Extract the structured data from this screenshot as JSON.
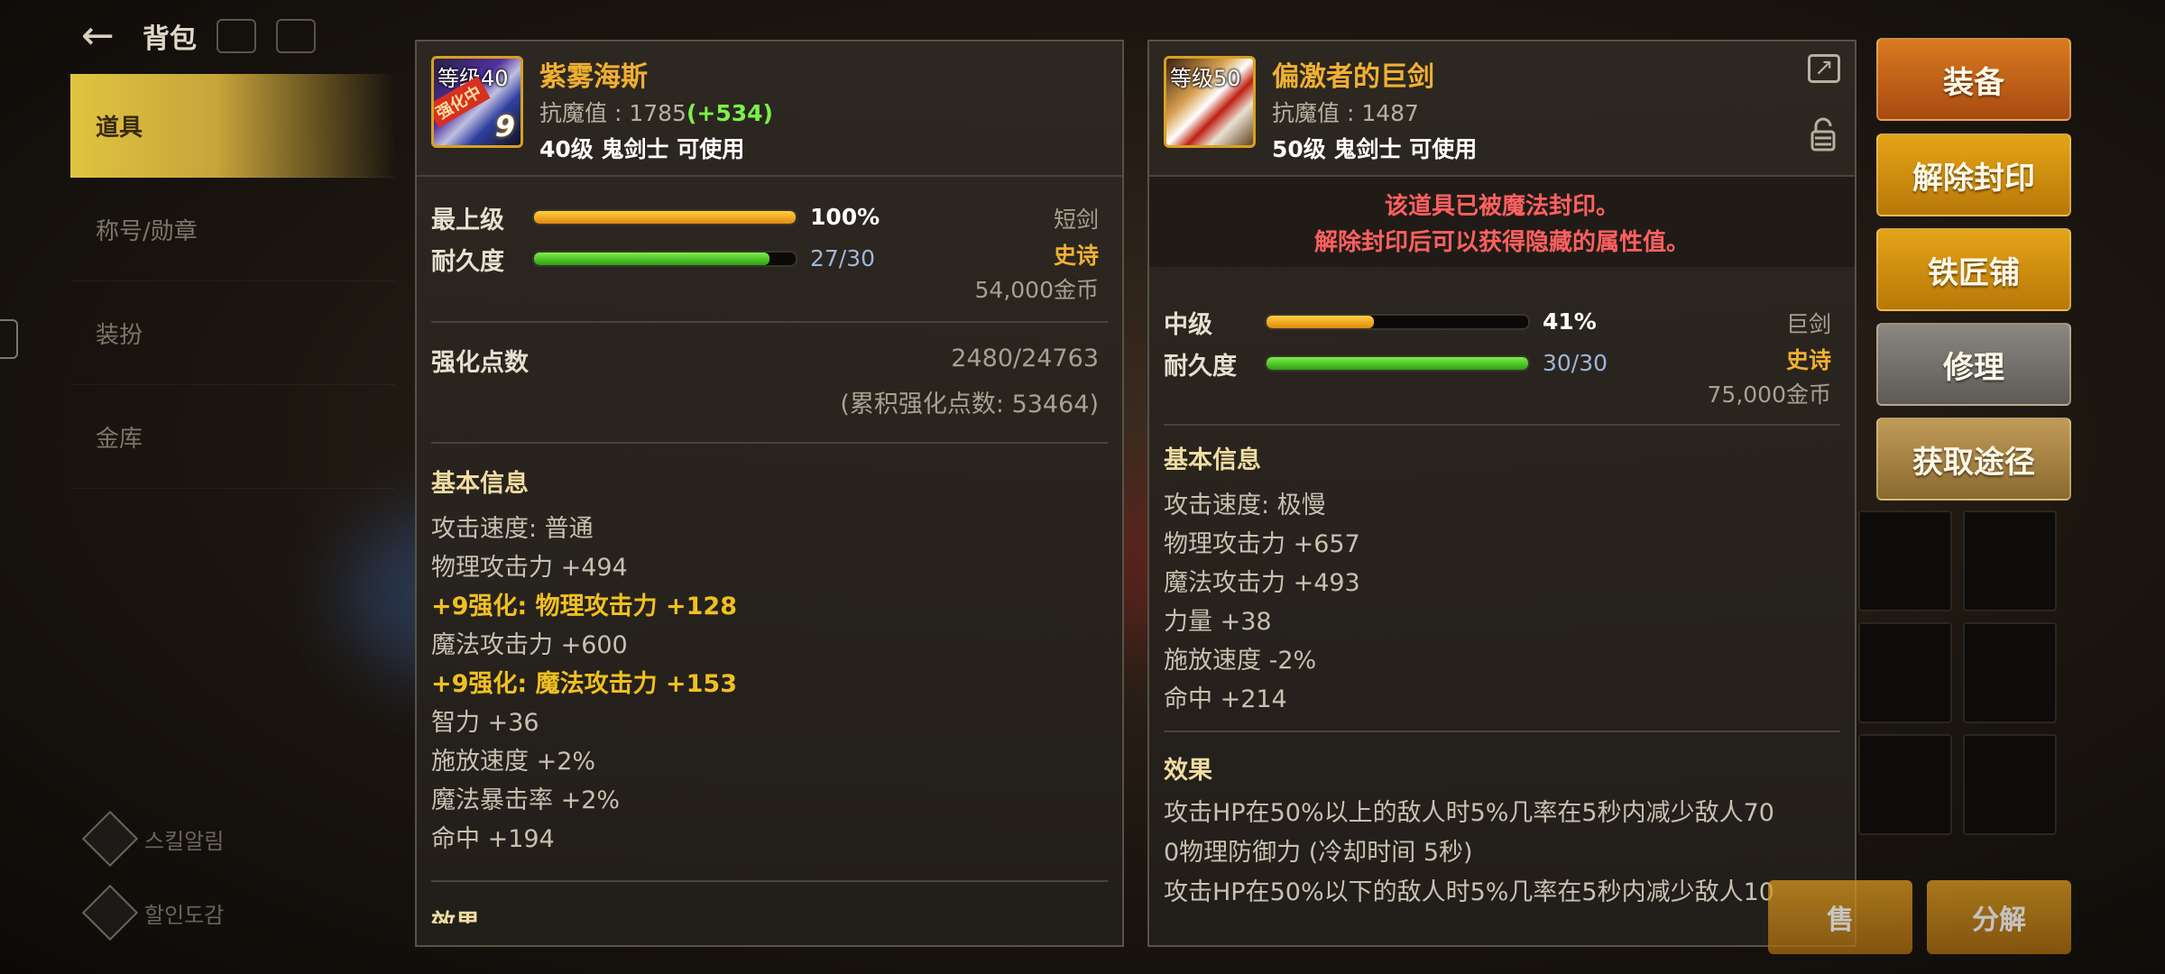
{
  "topbar": {
    "title": "背包"
  },
  "sidebar": {
    "items": [
      {
        "label": "道具",
        "active": true
      },
      {
        "label": "称号/勋章",
        "active": false
      },
      {
        "label": "装扮",
        "active": false
      },
      {
        "label": "金库",
        "active": false
      }
    ],
    "bottom": [
      "스킬알림",
      "할인도감"
    ]
  },
  "left_item": {
    "level_tag": "等级40",
    "ribbon": "强化中",
    "enhance": "9",
    "name": "紫雾海斯",
    "resist_label": "抗魔值 : 1785",
    "resist_bonus": "(+534)",
    "usable": "40级 鬼剑士 可使用",
    "grade_label": "最上级",
    "grade_pct": "100%",
    "grade_fill": 1.0,
    "durability_label": "耐久度",
    "durability": "27/30",
    "durability_fill": 0.9,
    "type": "短剑",
    "rarity": "史诗",
    "price": "54,000金币",
    "enhance_points_label": "强化点数",
    "enhance_points": "2480/24763",
    "enhance_points_total": "(累积强化点数: 53464)",
    "basic_info_title": "基本信息",
    "stats": [
      {
        "text": "攻击速度:  普通",
        "highlight": false
      },
      {
        "text": "物理攻击力 +494",
        "highlight": false
      },
      {
        "text": "+9强化:  物理攻击力 +128",
        "highlight": true
      },
      {
        "text": "魔法攻击力 +600",
        "highlight": false
      },
      {
        "text": "+9强化:  魔法攻击力 +153",
        "highlight": true
      },
      {
        "text": "智力 +36",
        "highlight": false
      },
      {
        "text": "施放速度 +2%",
        "highlight": false
      },
      {
        "text": "魔法暴击率 +2%",
        "highlight": false
      },
      {
        "text": "命中 +194",
        "highlight": false
      }
    ],
    "effect_title_partial": "效果"
  },
  "right_item": {
    "level_tag": "等级50",
    "name": "偏激者的巨剑",
    "resist_label": "抗魔值 : 1487",
    "usable": "50级 鬼剑士 可使用",
    "seal_line1": "该道具已被魔法封印。",
    "seal_line2": "解除封印后可以获得隐藏的属性值。",
    "grade_label": "中级",
    "grade_pct": "41%",
    "grade_fill": 0.41,
    "durability_label": "耐久度",
    "durability": "30/30",
    "durability_fill": 1.0,
    "type": "巨剑",
    "rarity": "史诗",
    "price": "75,000金币",
    "basic_info_title": "基本信息",
    "stats": [
      "攻击速度:  极慢",
      "物理攻击力 +657",
      "魔法攻击力 +493",
      "力量 +38",
      "施放速度 -2%",
      "命中 +214"
    ],
    "effect_title": "效果",
    "effect_lines": [
      "攻击HP在50%以上的敌人时5%几率在5秒内减少敌人70",
      "0物理防御力 (冷却时间 5秒)",
      "攻击HP在50%以下的敌人时5%几率在5秒内减少敌人10"
    ]
  },
  "actions": {
    "equip": "装备",
    "unseal": "解除封印",
    "blacksmith": "铁匠铺",
    "repair": "修理",
    "source": "获取途径"
  },
  "bottom_buttons": {
    "sell": "售",
    "disassemble": "分解"
  },
  "colors": {
    "epic": "#f0b030",
    "bonus": "#7cf04a",
    "seal": "#ff6060"
  }
}
